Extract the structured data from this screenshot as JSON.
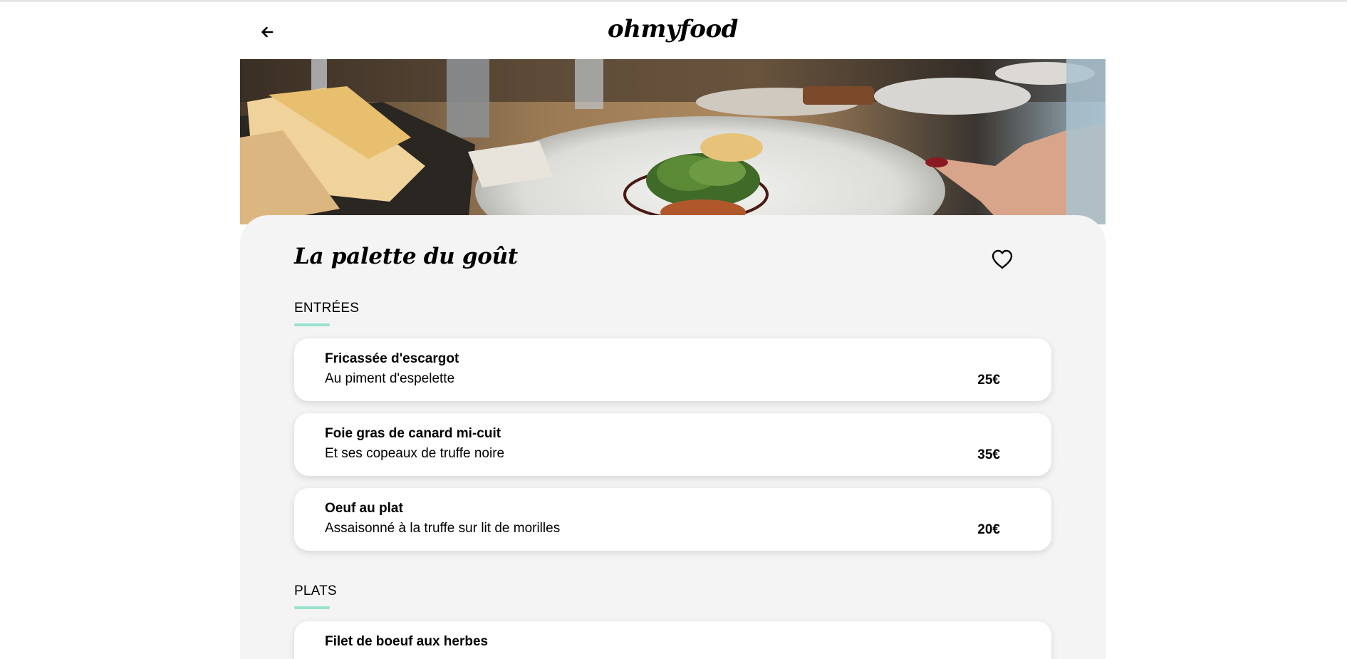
{
  "header": {
    "back_icon": "arrow-left-icon",
    "logo": "ohmyfood"
  },
  "hero": {
    "image": "plated-dish-restaurant-table-photo"
  },
  "restaurant": {
    "name": "La palette du goût",
    "favorite_icon": "heart-outline-icon"
  },
  "sections": [
    {
      "title": "ENTRÉES",
      "dishes": [
        {
          "name": "Fricassée d'escargot",
          "description": "Au piment d'espelette",
          "price": "25€"
        },
        {
          "name": "Foie gras de canard mi-cuit",
          "description": "Et ses copeaux de truffe noire",
          "price": "35€"
        },
        {
          "name": "Oeuf au plat",
          "description": "Assaisonné à la truffe sur lit de morilles",
          "price": "20€"
        }
      ]
    },
    {
      "title": "PLATS",
      "dishes": [
        {
          "name": "Filet de boeuf aux herbes",
          "description": "",
          "price": ""
        }
      ]
    }
  ],
  "colors": {
    "accent": "#99e2d0",
    "card_background": "#f4f4f4",
    "text": "#000000"
  }
}
